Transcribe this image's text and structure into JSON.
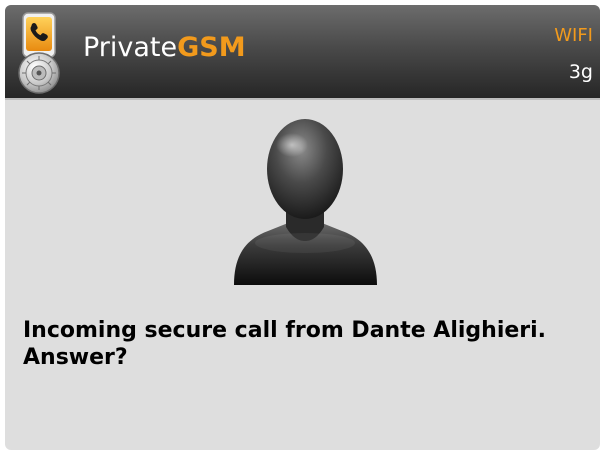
{
  "header": {
    "app_name_prefix": "Private",
    "app_name_suffix": "GSM",
    "app_icon": "phone-lock-icon",
    "connection": {
      "wifi_label": "WIFI",
      "network_label": "3g"
    }
  },
  "call": {
    "avatar_icon": "person-silhouette-icon",
    "prompt": "Incoming secure call from Dante Alighieri. Answer?"
  },
  "colors": {
    "accent": "#f29a1c",
    "header_dark": "#262626",
    "background": "#dedede",
    "text": "#000000"
  }
}
